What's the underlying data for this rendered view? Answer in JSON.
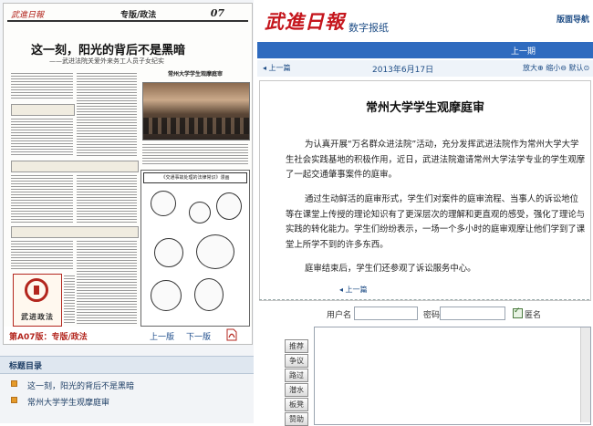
{
  "paper": {
    "mini_logo": "武進日報",
    "section": "专版/政法",
    "page_no": "07",
    "headline": "这一刻，阳光的背后不是黑暗",
    "subhead": "——武进法院关爱外来务工人员子女纪实",
    "photo_caption": "常州大学学生观摩庭审",
    "cartoon_title": "《交通事故处理的法律常识》漫画",
    "seal_text": "武进政法",
    "footer": {
      "edition_label": "第A07版：专版/政法",
      "prev_page": "上一版",
      "next_page": "下一版"
    }
  },
  "toc": {
    "heading": "标题目录",
    "items": [
      {
        "label": "这一刻，阳光的背后不是黑暗"
      },
      {
        "label": "常州大学学生观摩庭审"
      }
    ]
  },
  "header": {
    "logo": "武進日報",
    "site_name": "数字报纸",
    "nav_link": "版面导航"
  },
  "prev_issue": "上一期",
  "datebar": {
    "prev_article": "◂ 上一篇",
    "date": "2013年6月17日",
    "zoom_controls": "放大⊕ 缩小⊖ 默认⊙"
  },
  "article": {
    "title": "常州大学学生观摩庭审",
    "paragraphs": [
      "为认真开展“万名群众进法院”活动，充分发挥武进法院作为常州大学大学生社会实践基地的积极作用，近日，武进法院邀请常州大学法学专业的学生观摩了一起交通肇事案件的庭审。",
      "通过生动鲜活的庭审形式，学生们对案件的庭审流程、当事人的诉讼地位等在课堂上传授的理论知识有了更深层次的理解和更直观的感受，强化了理论与实践的转化能力。学生们纷纷表示，一场一个多小时的庭审观摩让他们学到了课堂上所学不到的许多东西。",
      "庭审结束后，学生们还参观了诉讼服务中心。"
    ],
    "prev_article": "◂ 上一篇"
  },
  "comment": {
    "username_label": "用户名",
    "password_label": "密码",
    "anonymous_label": "匿名",
    "username_value": "",
    "password_value": ""
  },
  "actions": [
    "推荐",
    "争议",
    "路过",
    "潜水",
    "板凳",
    "赞助"
  ],
  "colors": {
    "brand_red": "#c5161d",
    "nav_blue": "#2f6bbf",
    "link_blue": "#1e4d86",
    "toc_bullet": "#e59a2a"
  }
}
